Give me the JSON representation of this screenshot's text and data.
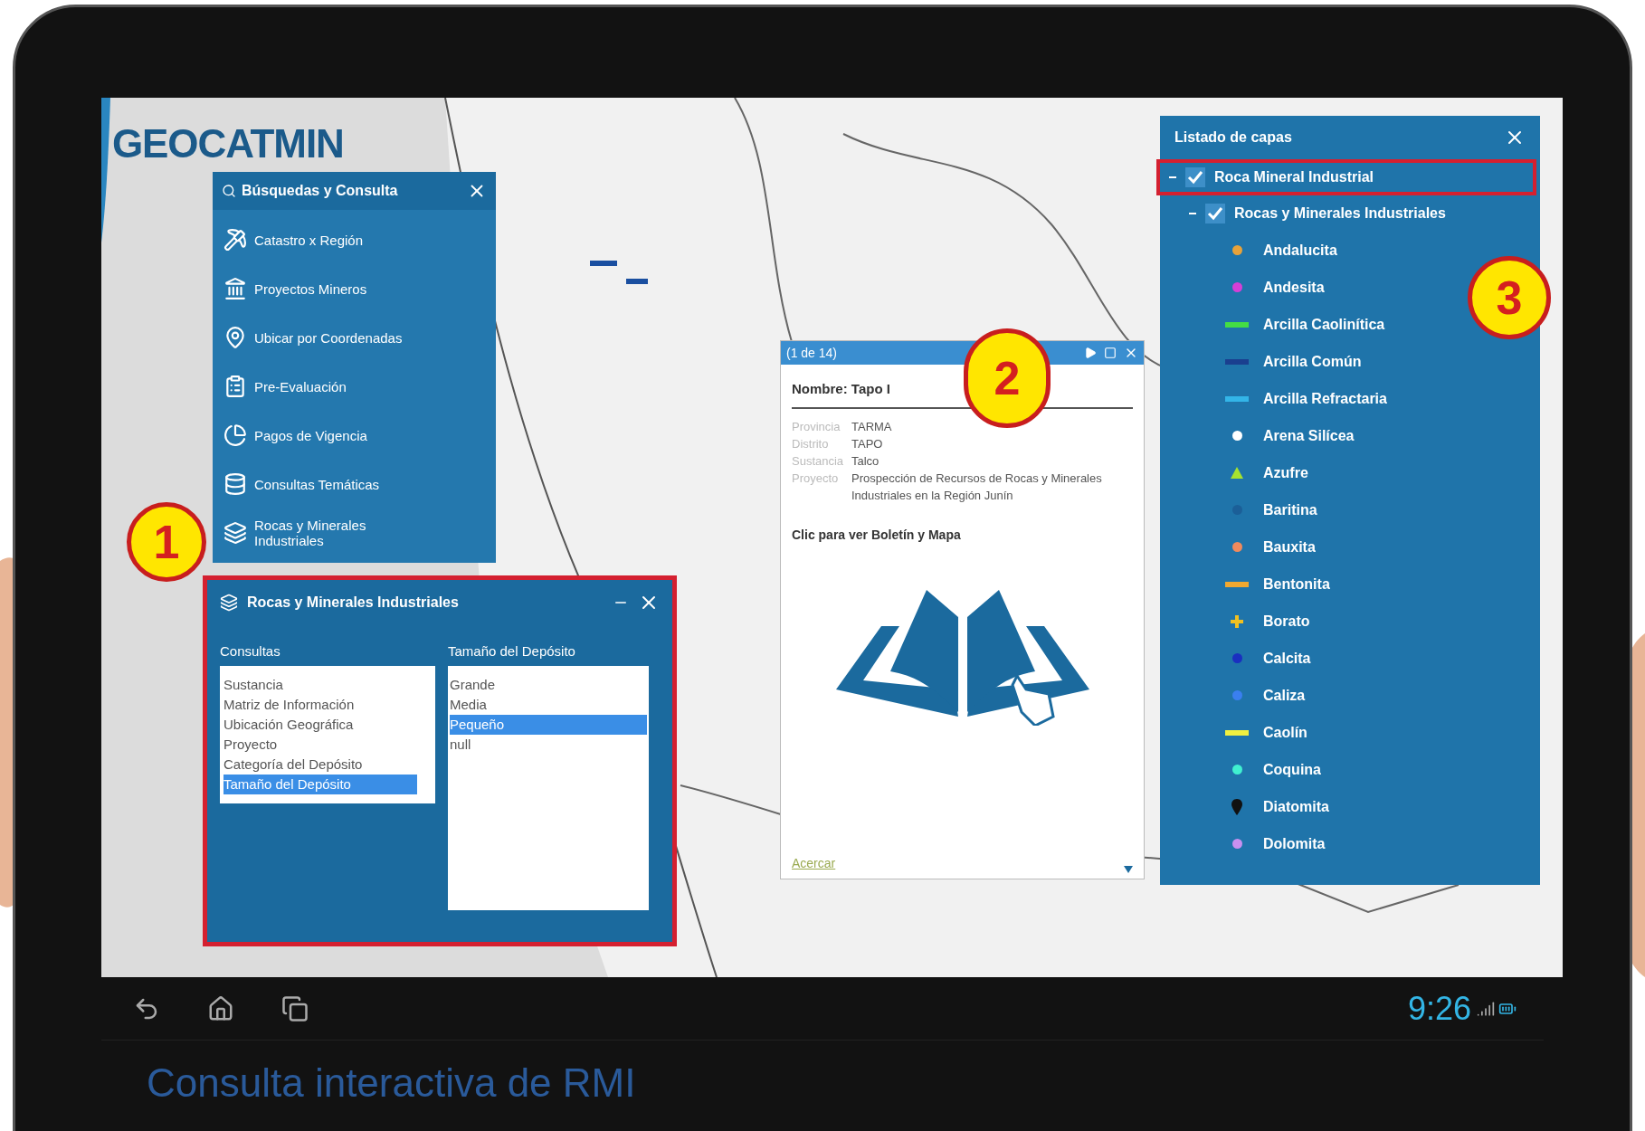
{
  "logo": {
    "text": "GEOCATMIN"
  },
  "search_panel": {
    "title": "Búsquedas y Consulta",
    "items": [
      {
        "label": "Catastro x Región"
      },
      {
        "label": "Proyectos Mineros"
      },
      {
        "label": "Ubicar por Coordenadas"
      },
      {
        "label": "Pre-Evaluación"
      },
      {
        "label": "Pagos de Vigencia"
      },
      {
        "label": "Consultas Temáticas"
      },
      {
        "label": "Rocas y Minerales Industriales"
      }
    ]
  },
  "rmi_panel": {
    "title": "Rocas y Minerales Industriales",
    "consultas_label": "Consultas",
    "consultas": [
      {
        "label": "Sustancia",
        "selected": false
      },
      {
        "label": "Matriz de Información",
        "selected": false
      },
      {
        "label": "Ubicación Geográfica",
        "selected": false
      },
      {
        "label": "Proyecto",
        "selected": false
      },
      {
        "label": "Categoría del Depósito",
        "selected": false
      },
      {
        "label": "Tamaño del Depósito",
        "selected": true
      }
    ],
    "values_label": "Tamaño del Depósito",
    "values": [
      {
        "label": "Grande",
        "selected": false
      },
      {
        "label": "Media",
        "selected": false
      },
      {
        "label": "Pequeño",
        "selected": true
      },
      {
        "label": "null",
        "selected": false
      }
    ]
  },
  "popup": {
    "counter": "(1 de 14)",
    "name": "Nombre: Tapo I",
    "fields": [
      {
        "label": "Provincia",
        "value": "TARMA"
      },
      {
        "label": "Distrito",
        "value": "TAPO"
      },
      {
        "label": "Sustancia",
        "value": "Talco"
      },
      {
        "label": "Proyecto",
        "value": "Prospección de Recursos de Rocas y Minerales Industriales en la Región Junín"
      }
    ],
    "link_text": "Clic para ver Boletín y Mapa",
    "footer_link": "Acercar"
  },
  "layers_panel": {
    "title": "Listado de capas",
    "tree": [
      {
        "label": "Roca Mineral Industrial",
        "checked": true,
        "highlighted": true,
        "children": [
          {
            "label": "Rocas y Minerales Industriales",
            "checked": true,
            "highlighted": false,
            "children": [
              {
                "label": "Andalucita",
                "kind": "dot",
                "color": "#e8a23a"
              },
              {
                "label": "Andesita",
                "kind": "dot",
                "color": "#d63fd6"
              },
              {
                "label": "Arcilla Caolinítica",
                "kind": "bar",
                "color": "#44dd44"
              },
              {
                "label": "Arcilla Común",
                "kind": "bar",
                "color": "#1a3f8f"
              },
              {
                "label": "Arcilla Refractaria",
                "kind": "bar",
                "color": "#33b5e8"
              },
              {
                "label": "Arena Silícea",
                "kind": "dot",
                "color": "#ffffff"
              },
              {
                "label": "Azufre",
                "kind": "triangle",
                "color": "#a6e22e"
              },
              {
                "label": "Baritina",
                "kind": "dot",
                "color": "#1b5f98"
              },
              {
                "label": "Bauxita",
                "kind": "dot",
                "color": "#f08a5d"
              },
              {
                "label": "Bentonita",
                "kind": "bar",
                "color": "#f0a830"
              },
              {
                "label": "Borato",
                "kind": "cross",
                "color": "#f0c020"
              },
              {
                "label": "Calcita",
                "kind": "dot",
                "color": "#1a2fc0"
              },
              {
                "label": "Caliza",
                "kind": "dot",
                "color": "#3a7ff0"
              },
              {
                "label": "Caolín",
                "kind": "bar",
                "color": "#f0f040"
              },
              {
                "label": "Coquina",
                "kind": "dot",
                "color": "#40f0d0"
              },
              {
                "label": "Diatomita",
                "kind": "pin",
                "color": "#111111"
              },
              {
                "label": "Dolomita",
                "kind": "dot",
                "color": "#c890f0"
              }
            ]
          }
        ]
      }
    ]
  },
  "badges": [
    "1",
    "2",
    "3"
  ],
  "status_bar": {
    "clock": "9:26"
  },
  "caption": "Consulta interactiva de RMI"
}
